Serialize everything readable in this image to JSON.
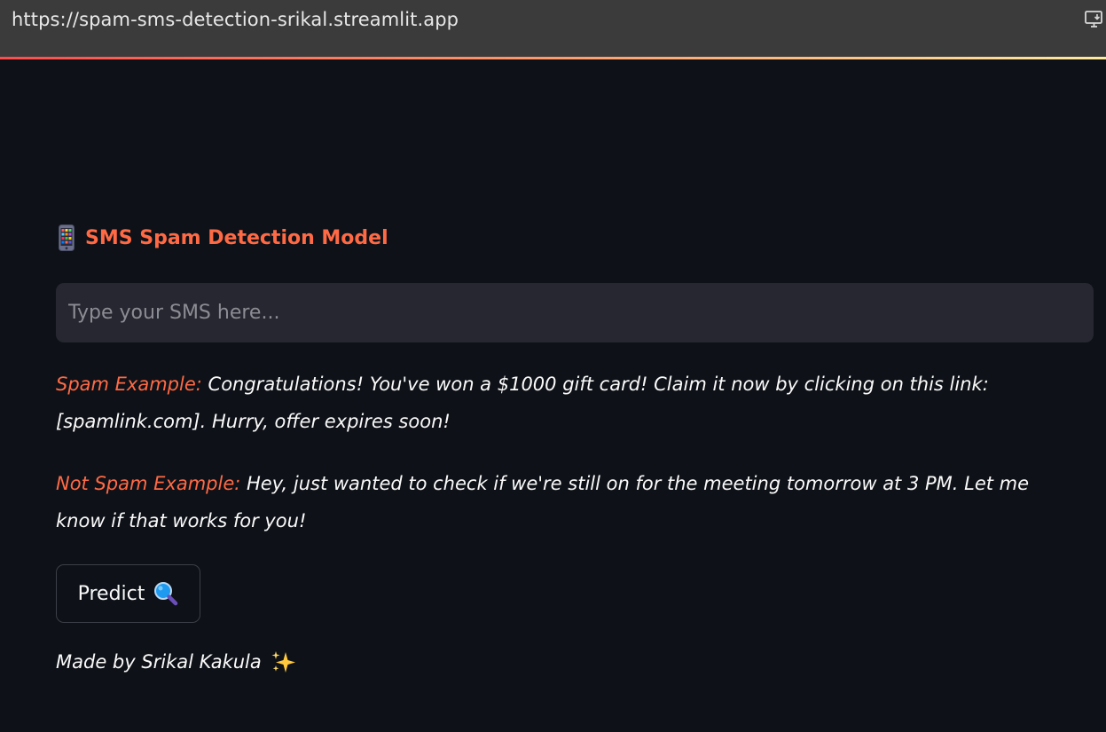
{
  "browser": {
    "url": "https://spam-sms-detection-srikal.streamlit.app",
    "install_icon": "install-app-icon"
  },
  "app": {
    "title_icon": "mobile-phone-icon",
    "title": "SMS Spam Detection Model",
    "input": {
      "value": "",
      "placeholder": "Type your SMS here..."
    },
    "spam_example": {
      "label": "Spam Example:",
      "text": "Congratulations! You've won a $1000 gift card! Claim it now by clicking on this link: [spamlink.com]. Hurry, offer expires soon!"
    },
    "not_spam_example": {
      "label": "Not Spam Example:",
      "text": "Hey, just wanted to check if we're still on for the meeting tomorrow at 3 PM. Let me know if that works for you!"
    },
    "predict_button": {
      "label": "Predict",
      "icon": "magnifying-glass-icon"
    },
    "footer": {
      "text": "Made by Srikal Kakula",
      "icon": "sparkles-icon"
    }
  },
  "colors": {
    "background": "#0e1117",
    "accent": "#ff6a45",
    "input_bg": "#262730",
    "text": "#fafafa",
    "urlbar_bg": "#3b3b3b"
  }
}
